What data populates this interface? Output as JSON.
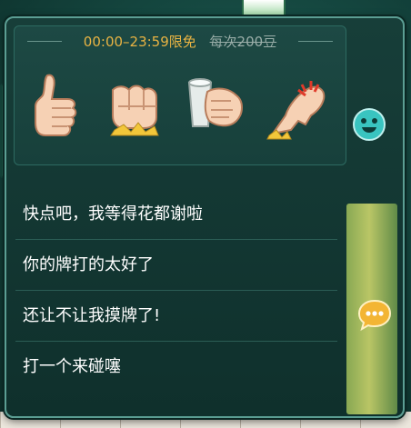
{
  "promo": {
    "time": "00:00–23:59限免",
    "price": "每次200豆"
  },
  "gestures": [
    {
      "icon": "thumbs-up-icon"
    },
    {
      "icon": "fist-slam-icon"
    },
    {
      "icon": "cup-toast-icon"
    },
    {
      "icon": "angry-hand-icon"
    }
  ],
  "icons": {
    "emoji_tab": "smiley-icon",
    "phrase_tab": "speech-bubble-icon"
  },
  "phrases": [
    "快点吧，我等得花都谢啦",
    "你的牌打的太好了",
    "还让不让我摸牌了!",
    "打一个来碰噻"
  ],
  "colors": {
    "accent_gold": "#e8b343",
    "panel_border": "#5b9e93",
    "active_tab": "#d7df6f"
  }
}
